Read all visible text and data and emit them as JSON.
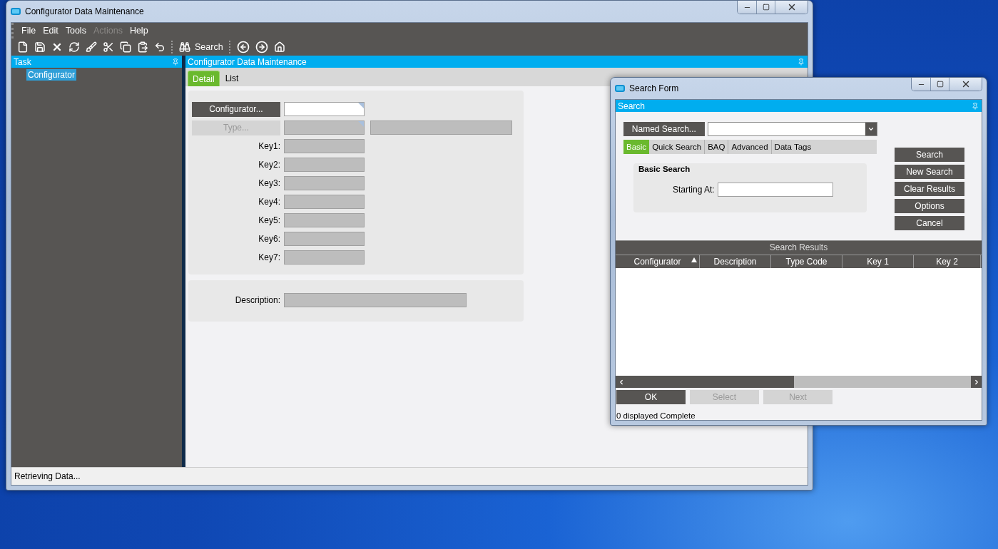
{
  "main_window": {
    "title": "Configurator Data Maintenance",
    "menu": [
      {
        "label": "File",
        "disabled": false
      },
      {
        "label": "Edit",
        "disabled": false
      },
      {
        "label": "Tools",
        "disabled": false
      },
      {
        "label": "Actions",
        "disabled": true
      },
      {
        "label": "Help",
        "disabled": false
      }
    ],
    "toolbar": [
      {
        "kind": "new"
      },
      {
        "kind": "save"
      },
      {
        "kind": "delete"
      },
      {
        "kind": "refresh"
      },
      {
        "kind": "clear"
      },
      {
        "kind": "cut"
      },
      {
        "kind": "copy"
      },
      {
        "kind": "paste"
      },
      {
        "kind": "undo"
      },
      {
        "kind": "separator"
      },
      {
        "kind": "search",
        "label": "Search"
      },
      {
        "kind": "separator"
      },
      {
        "kind": "back"
      },
      {
        "kind": "forward"
      },
      {
        "kind": "home"
      }
    ],
    "task_panel": {
      "title": "Task",
      "items": [
        {
          "label": "Configurator",
          "selected": true
        }
      ]
    },
    "content": {
      "title": "Configurator Data Maintenance",
      "tabs": [
        {
          "label": "Detail",
          "selected": true
        },
        {
          "label": "List",
          "selected": false
        }
      ],
      "rows": [
        {
          "kind": "lookup",
          "label": "Configurator...",
          "disabled": false,
          "field_disabled": false
        },
        {
          "kind": "lookup",
          "label": "Type...",
          "disabled": true,
          "field_disabled": true,
          "has_description": true
        },
        {
          "kind": "key",
          "label": "Key1:",
          "field_disabled": true
        },
        {
          "kind": "key",
          "label": "Key2:",
          "field_disabled": true
        },
        {
          "kind": "key",
          "label": "Key3:",
          "field_disabled": true
        },
        {
          "kind": "key",
          "label": "Key4:",
          "field_disabled": true
        },
        {
          "kind": "key",
          "label": "Key5:",
          "field_disabled": true
        },
        {
          "kind": "key",
          "label": "Key6:",
          "field_disabled": true
        },
        {
          "kind": "key",
          "label": "Key7:",
          "field_disabled": true
        }
      ],
      "description": {
        "label": "Description:",
        "field_disabled": true
      }
    },
    "status_bar": "Retrieving Data..."
  },
  "search_window": {
    "title": "Search Form",
    "panel_title": "Search",
    "named_search": "Named Search...",
    "tabs": [
      {
        "label": "Basic",
        "selected": true
      },
      {
        "label": "Quick Search",
        "selected": false
      },
      {
        "label": "BAQ",
        "selected": false
      },
      {
        "label": "Advanced",
        "selected": false
      },
      {
        "label": "Data Tags",
        "selected": false
      }
    ],
    "group_title": "Basic Search",
    "starting_at_label": "Starting At:",
    "buttons": [
      "Search",
      "New Search",
      "Clear Results",
      "Options",
      "Cancel"
    ],
    "results": {
      "title": "Search Results",
      "columns": [
        {
          "label": "Configurator",
          "sorted": true
        },
        {
          "label": "Description",
          "sorted": false
        },
        {
          "label": "Type Code",
          "sorted": false
        },
        {
          "label": "Key 1",
          "sorted": false
        },
        {
          "label": "Key 2",
          "sorted": false
        }
      ]
    },
    "footer_buttons": [
      {
        "label": "OK",
        "disabled": false
      },
      {
        "label": "Select",
        "disabled": true
      },
      {
        "label": "Next",
        "disabled": true
      }
    ],
    "status": "0 displayed Complete"
  }
}
